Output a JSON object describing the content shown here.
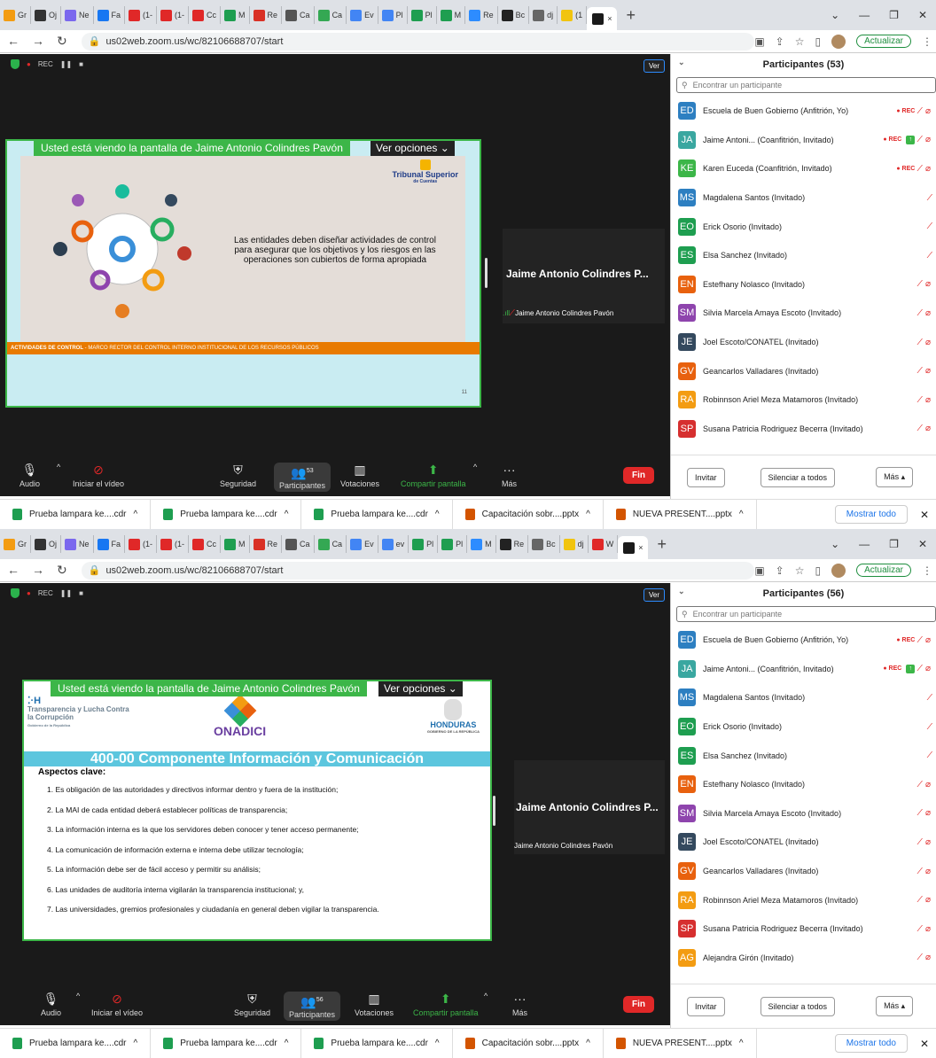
{
  "colors": {
    "zoom_bg": "#1a1a1a",
    "share_border": "#3cb648",
    "end_red": "#e02828",
    "browser_tabbar": "#dee1e6"
  },
  "browser": {
    "url": "us02web.zoom.us/wc/82106688707/start",
    "update_label": "Actualizar",
    "tabs_top": [
      "Gr",
      "Oj",
      "Ne",
      "Fa",
      "(1-",
      "(1-",
      "Cc",
      "M",
      "Re",
      "Ca",
      "Ca",
      "Ev",
      "Pl",
      "Pl",
      "M",
      "Re",
      "Bc",
      "dj",
      "(1"
    ],
    "tabs_bottom": [
      "Gr",
      "Oj",
      "Ne",
      "Fa",
      "(1-",
      "(1-",
      "Cc",
      "M",
      "Re",
      "Ca",
      "Ca",
      "Ev",
      "ev",
      "Pl",
      "Pl",
      "M",
      "Re",
      "Bc",
      "dj",
      "W"
    ],
    "close_tab": "×"
  },
  "downloads": {
    "items": [
      "Prueba lampara ke....cdr",
      "Prueba lampara ke....cdr",
      "Prueba lampara ke....cdr",
      "Capacitación sobr....pptx",
      "NUEVA PRESENT....pptx"
    ],
    "show_all": "Mostrar todo"
  },
  "zoom": {
    "rec": "REC",
    "ver": "Ver",
    "banner": "Usted está viendo la pantalla de Jaime Antonio Colindres Pavón",
    "ver_opciones": "Ver opciones",
    "speaker_title": "Jaime Antonio Colindres P...",
    "speaker_name": "Jaime Antonio Colindres Pavón",
    "toolbar": {
      "audio": "Audio",
      "video": "Iniciar el vídeo",
      "security": "Seguridad",
      "participants": "Participantes",
      "votes": "Votaciones",
      "share": "Compartir pantalla",
      "more": "Más",
      "end": "Fin"
    }
  },
  "slide1": {
    "text": "Las entidades deben diseñar actividades de control para asegurar que los objetivos y los riesgos en las operaciones son cubiertos de forma apropiada",
    "footer_bold": "ACTIVIDADES DE CONTROL",
    "footer_rest": " - MARCO RECTOR DEL CONTROL INTERNO INSTITUCIONAL DE LOS RECURSOS PÚBLICOS",
    "logo": "Tribunal Superior",
    "logo_sub": "de Cuentas",
    "page": "11"
  },
  "slide2": {
    "logo_left": "Transparencia y Lucha Contra la Corrupción",
    "logo_left_sub": "Gobierno de la República",
    "logo_mid": "ONADICI",
    "logo_right": "HONDURAS",
    "logo_right_sub": "GOBIERNO DE LA REPÚBLICA",
    "title": "400-00 Componente Información y Comunicación",
    "subtitle": "Aspectos clave:",
    "items": [
      "1. Es obligación de las autoridades y directivos informar dentro y fuera de la institución;",
      "2. La MAI de cada entidad deberá establecer políticas de transparencia;",
      "3. La información interna es la que los servidores deben conocer y tener acceso permanente;",
      "4. La comunicación de información externa e interna debe utilizar tecnología;",
      "5. La información debe ser de fácil acceso y permitir su análisis;",
      "6. Las unidades de auditoría interna vigilarán la transparencia institucional; y,",
      "7. Las universidades, gremios profesionales y ciudadanía en general deben vigilar la transparencia."
    ]
  },
  "panel_top": {
    "title": "Participantes (53)",
    "search_placeholder": "Encontrar un participante",
    "count_badge": "53",
    "participants": [
      {
        "ini": "ED",
        "name": "Escuela de Buen Gobierno (Anfitrión, Yo)",
        "color": "#2d7fc1",
        "rec": true,
        "share": false,
        "cam": true
      },
      {
        "ini": "JA",
        "name": "Jaime Antoni... (Coanfitrión, Invitado)",
        "color": "#3aa7a0",
        "rec": true,
        "share": true,
        "cam": true
      },
      {
        "ini": "KE",
        "name": "Karen Euceda (Coanfitrión, Invitado)",
        "color": "#3cb648",
        "rec": true,
        "share": false,
        "cam": true
      },
      {
        "ini": "MS",
        "name": "Magdalena Santos (Invitado)",
        "color": "#2d7fc1",
        "rec": false,
        "share": false,
        "cam": false
      },
      {
        "ini": "EO",
        "name": "Erick Osorio (Invitado)",
        "color": "#1e9e50",
        "rec": false,
        "share": false,
        "cam": false
      },
      {
        "ini": "ES",
        "name": "Elsa Sanchez (Invitado)",
        "color": "#1e9e50",
        "rec": false,
        "share": false,
        "cam": false
      },
      {
        "ini": "EN",
        "name": "Estefhany Nolasco (Invitado)",
        "color": "#e8610e",
        "rec": false,
        "share": false,
        "cam": true
      },
      {
        "ini": "SM",
        "name": "Silvia Marcela Amaya Escoto (Invitado)",
        "color": "#8e44ad",
        "rec": false,
        "share": false,
        "cam": true
      },
      {
        "ini": "JE",
        "name": "Joel Escoto/CONATEL (Invitado)",
        "color": "#34495e",
        "rec": false,
        "share": false,
        "cam": true
      },
      {
        "ini": "GV",
        "name": "Geancarlos Valladares (Invitado)",
        "color": "#e8610e",
        "rec": false,
        "share": false,
        "cam": true
      },
      {
        "ini": "RA",
        "name": "Robinnson Ariel Meza Matamoros (Invitado)",
        "color": "#f39c12",
        "rec": false,
        "share": false,
        "cam": true
      },
      {
        "ini": "SP",
        "name": "Susana Patricia Rodriguez Becerra (Invitado)",
        "color": "#d62f2f",
        "rec": false,
        "share": false,
        "cam": true
      }
    ]
  },
  "panel_bottom": {
    "title": "Participantes (56)",
    "search_placeholder": "Encontrar un participante",
    "count_badge": "56",
    "participants": [
      {
        "ini": "ED",
        "name": "Escuela de Buen Gobierno (Anfitrión, Yo)",
        "color": "#2d7fc1",
        "rec": true,
        "share": false,
        "cam": true
      },
      {
        "ini": "JA",
        "name": "Jaime Antoni... (Coanfitrión, Invitado)",
        "color": "#3aa7a0",
        "rec": true,
        "share": true,
        "cam": true
      },
      {
        "ini": "MS",
        "name": "Magdalena Santos (Invitado)",
        "color": "#2d7fc1",
        "rec": false,
        "share": false,
        "cam": false
      },
      {
        "ini": "EO",
        "name": "Erick Osorio (Invitado)",
        "color": "#1e9e50",
        "rec": false,
        "share": false,
        "cam": false
      },
      {
        "ini": "ES",
        "name": "Elsa Sanchez (Invitado)",
        "color": "#1e9e50",
        "rec": false,
        "share": false,
        "cam": false
      },
      {
        "ini": "EN",
        "name": "Estefhany Nolasco (Invitado)",
        "color": "#e8610e",
        "rec": false,
        "share": false,
        "cam": true
      },
      {
        "ini": "SM",
        "name": "Silvia Marcela Amaya Escoto (Invitado)",
        "color": "#8e44ad",
        "rec": false,
        "share": false,
        "cam": true
      },
      {
        "ini": "JE",
        "name": "Joel Escoto/CONATEL (Invitado)",
        "color": "#34495e",
        "rec": false,
        "share": false,
        "cam": true
      },
      {
        "ini": "GV",
        "name": "Geancarlos Valladares (Invitado)",
        "color": "#e8610e",
        "rec": false,
        "share": false,
        "cam": true
      },
      {
        "ini": "RA",
        "name": "Robinnson Ariel Meza Matamoros (Invitado)",
        "color": "#f39c12",
        "rec": false,
        "share": false,
        "cam": true
      },
      {
        "ini": "SP",
        "name": "Susana Patricia Rodriguez Becerra (Invitado)",
        "color": "#d62f2f",
        "rec": false,
        "share": false,
        "cam": true
      },
      {
        "ini": "AG",
        "name": "Alejandra Girón (Invitado)",
        "color": "#f39c12",
        "rec": false,
        "share": false,
        "cam": true
      }
    ]
  },
  "panel_buttons": {
    "invite": "Invitar",
    "mute_all": "Silenciar a todos",
    "more": "Más"
  }
}
